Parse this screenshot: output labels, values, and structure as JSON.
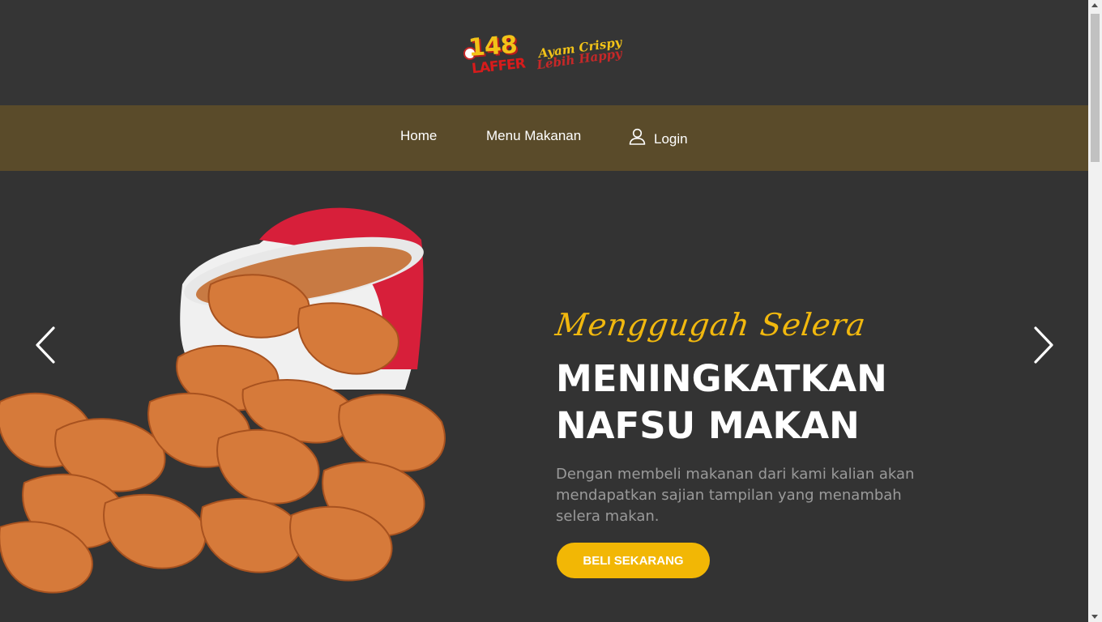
{
  "logo": {
    "number": "148",
    "wordmark": "LAFFER",
    "script_line1": "Ayam Crispy",
    "script_line2": "Lebih Happy"
  },
  "nav": {
    "home": "Home",
    "menu": "Menu Makanan",
    "login": "Login"
  },
  "hero": {
    "tagline": "Menggugah Selera",
    "headline": "MENINGKATKAN NAFSU MAKAN",
    "description": "Dengan membeli makanan dari kami kalian akan mendapatkan sajian tampilan yang menambah selera makan.",
    "cta": "BELI SEKARANG"
  },
  "icons": {
    "user": "user-icon",
    "prev": "chevron-left-icon",
    "next": "chevron-right-icon"
  },
  "colors": {
    "background": "#333333",
    "nav": "#5a4b2a",
    "accent": "#f2b705",
    "tagline": "#f1b80e"
  }
}
